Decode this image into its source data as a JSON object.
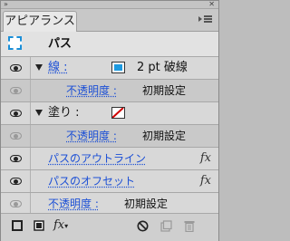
{
  "panel": {
    "tab_title": "アピアランス",
    "colors": {
      "link": "#1b4fd6",
      "stroke_color": "#1d9ae0",
      "fill_slash": "#d00000"
    }
  },
  "header": {
    "title": "パス"
  },
  "stroke": {
    "label": "線 :",
    "value": "2 pt 破線",
    "opacity_label": "不透明度 :",
    "opacity_value": "初期設定"
  },
  "fill": {
    "label": "塗り :",
    "opacity_label": "不透明度 :",
    "opacity_value": "初期設定"
  },
  "effects": [
    {
      "label": "パスのアウトライン",
      "icon": "fx-icon"
    },
    {
      "label": "パスのオフセット",
      "icon": "fx-icon"
    }
  ],
  "object_opacity": {
    "label": "不透明度 :",
    "value": "初期設定"
  },
  "toolbar": {
    "icons": [
      "add-new-stroke-icon",
      "add-new-fill-icon",
      "add-new-effect-icon",
      "clear-appearance-icon",
      "duplicate-item-icon",
      "delete-item-icon"
    ],
    "fx_label": "fx"
  }
}
